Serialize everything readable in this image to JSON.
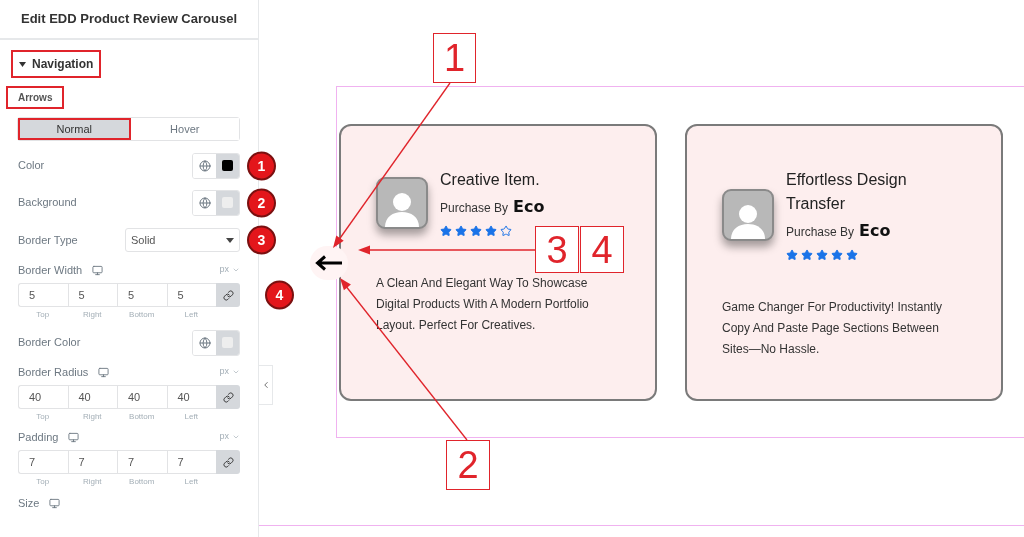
{
  "panel": {
    "title": "Edit EDD Product Review Carousel",
    "section": {
      "label": "Navigation",
      "expanded": true,
      "highlighted": true
    },
    "subheading": {
      "label": "Arrows",
      "highlighted": true
    },
    "tabs": [
      {
        "label": "Normal",
        "selected": true,
        "highlighted": true
      },
      {
        "label": "Hover",
        "selected": false,
        "highlighted": false
      }
    ],
    "controls": [
      {
        "kind": "color",
        "label": "Color",
        "color": "#000000",
        "badge": "1"
      },
      {
        "kind": "color",
        "label": "Background",
        "color": "#eeeeee",
        "badge": "2"
      },
      {
        "kind": "select",
        "label": "Border Type",
        "value": "Solid",
        "badge": "3"
      },
      {
        "kind": "dimensions",
        "label": "Border Width",
        "unit": "px",
        "badge": "4",
        "fields": [
          {
            "value": "5",
            "label": "Top"
          },
          {
            "value": "5",
            "label": "Right"
          },
          {
            "value": "5",
            "label": "Bottom"
          },
          {
            "value": "5",
            "label": "Left"
          }
        ]
      },
      {
        "kind": "color",
        "label": "Border Color",
        "color": "#eeeeee"
      },
      {
        "kind": "dimensions",
        "label": "Border Radius",
        "unit": "px",
        "fields": [
          {
            "value": "40",
            "label": "Top"
          },
          {
            "value": "40",
            "label": "Right"
          },
          {
            "value": "40",
            "label": "Bottom"
          },
          {
            "value": "40",
            "label": "Left"
          }
        ]
      },
      {
        "kind": "dimensions",
        "label": "Padding",
        "unit": "px",
        "fields": [
          {
            "value": "7",
            "label": "Top"
          },
          {
            "value": "7",
            "label": "Right"
          },
          {
            "value": "7",
            "label": "Bottom"
          },
          {
            "value": "7",
            "label": "Left"
          }
        ]
      },
      {
        "kind": "heading",
        "label": "Size"
      }
    ]
  },
  "carousel": {
    "cards": [
      {
        "title": "Creative Item.",
        "purchase_label": "Purchase By",
        "author": "Eco",
        "stars": 4,
        "description": "A Clean And Elegant Way To Showcase Digital Products With A Modern Portfolio Layout. Perfect For Creatives."
      },
      {
        "title": "Effortless Design Transfer",
        "purchase_label": "Purchase By",
        "author": "Eco",
        "stars": 5,
        "description": "Game Changer For Productivity! Instantly Copy And Paste Page Sections Between Sites—No Hassle."
      }
    ]
  },
  "callouts": [
    {
      "label": "1"
    },
    {
      "label": "2"
    },
    {
      "label": "3"
    },
    {
      "label": "4"
    }
  ]
}
